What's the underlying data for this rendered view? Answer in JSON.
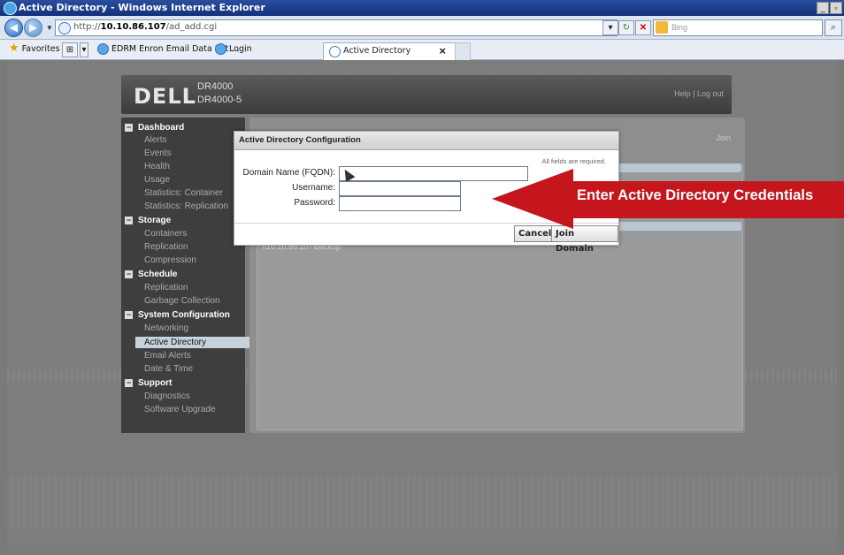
{
  "window": {
    "title": "Active Directory - Windows Internet Explorer"
  },
  "address_bar": {
    "url_prefix": "http://",
    "url_host": "10.10.86.107",
    "url_path": "/ad_add.cgi",
    "search_placeholder": "Bing"
  },
  "favorites": {
    "label": "Favorites",
    "items": [
      {
        "label": "EDRM Enron Email Data Set ..."
      },
      {
        "label": "Login"
      }
    ]
  },
  "tab": {
    "label": "Active Directory"
  },
  "header": {
    "logo": "DELL",
    "model1": "DR4000",
    "model2": "DR4000-5",
    "help": "Help",
    "separator": "|",
    "logout": "Log out"
  },
  "sidebar": {
    "dashboard": {
      "label": "Dashboard",
      "items": [
        "Alerts",
        "Events",
        "Health",
        "Usage",
        "Statistics: Container",
        "Statistics: Replication"
      ]
    },
    "storage": {
      "label": "Storage",
      "items": [
        "Containers",
        "Replication",
        "Compression"
      ]
    },
    "schedule": {
      "label": "Schedule",
      "items": [
        "Replication",
        "Garbage Collection"
      ]
    },
    "system": {
      "label": "System Configuration",
      "items": [
        "Networking",
        "Active Directory",
        "Email Alerts",
        "Date & Time"
      ]
    },
    "support": {
      "label": "Support",
      "items": [
        "Diagnostics",
        "Software Upgrade"
      ]
    }
  },
  "content": {
    "join_link": "Join",
    "backup_path": "\\\\10.10.86.107\\backup"
  },
  "dialog": {
    "title": "Active Directory Configuration",
    "required_note": "All fields are required.",
    "domain_label": "Domain Name (FQDN):",
    "username_label": "Username:",
    "password_label": "Password:",
    "domain_value": "",
    "username_value": "",
    "password_value": "",
    "cancel": "Cancel",
    "join": "Join Domain"
  },
  "annotation": {
    "text": "Enter Active Directory Credentials",
    "color": "#c4161c"
  }
}
